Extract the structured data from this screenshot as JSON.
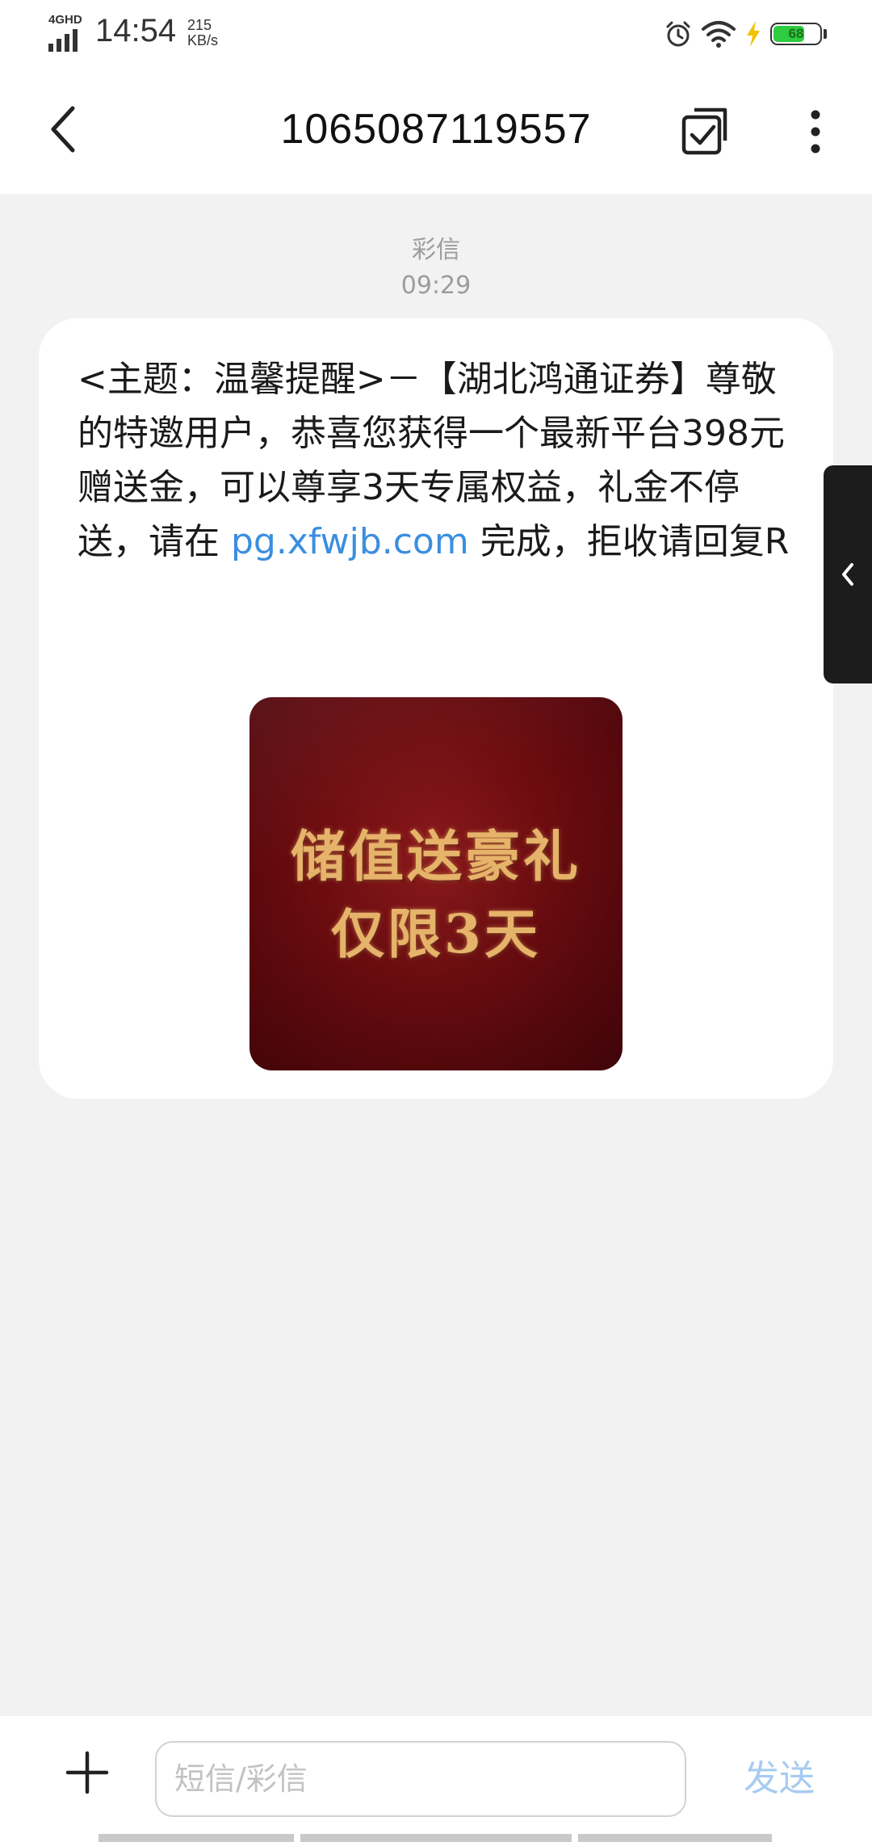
{
  "status_bar": {
    "network": "4GHD",
    "time": "14:54",
    "speed_value": "215",
    "speed_unit": "KB/s",
    "battery_level": "68",
    "icons": [
      "alarm-icon",
      "wifi-icon",
      "charging-icon",
      "battery-icon"
    ]
  },
  "header": {
    "title": "1065087119557",
    "back_icon": "chevron-left-icon",
    "select_icon": "multi-select-icon",
    "more_icon": "more-vertical-icon"
  },
  "message": {
    "type_label": "彩信",
    "time": "09:29",
    "text_before_link": "<主题：温馨提醒>－【湖北鸿通证券】尊敬的特邀用户，恭喜您获得一个最新平台398元赠送金，可以尊享3天专属权益，礼金不停送，请在 ",
    "link": "pg.xfwjb.com",
    "text_after_link": " 完成，拒收请回复R",
    "image": {
      "line1": "储值送豪礼",
      "line2": "仅限3天"
    }
  },
  "composer": {
    "add_icon": "plus-icon",
    "placeholder": "短信/彩信",
    "value": "",
    "send_label": "发送"
  },
  "colors": {
    "link": "#3b8ee0",
    "send_disabled": "#a6cbf0",
    "background": "#f2f2f2",
    "image_red": "#6e0c10",
    "image_gold": "#e6b36a"
  }
}
